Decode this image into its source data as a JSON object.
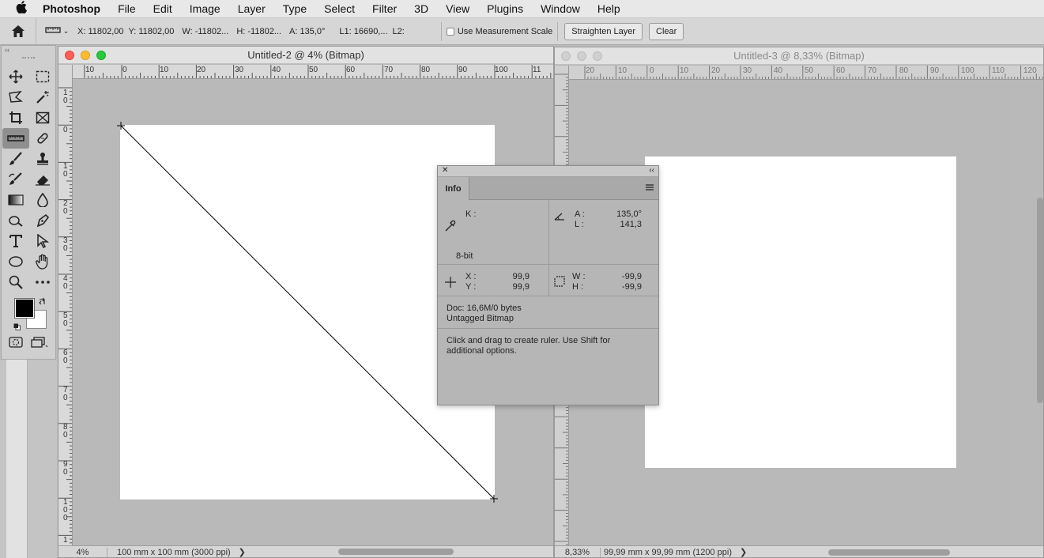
{
  "menubar": {
    "app": "Photoshop",
    "items": [
      "File",
      "Edit",
      "Image",
      "Layer",
      "Type",
      "Select",
      "Filter",
      "3D",
      "View",
      "Plugins",
      "Window",
      "Help"
    ]
  },
  "options": {
    "x": "X: 11802,00",
    "y": "Y: 11802,00",
    "w": "W: -11802...",
    "h": "H: -11802...",
    "a": "A: 135,0°",
    "l1": "L1: 16690,...",
    "l2": "L2:",
    "measurement_scale": "Use Measurement Scale",
    "straighten": "Straighten Layer",
    "clear": "Clear"
  },
  "doc1": {
    "title": "Untitled-2 @ 4% (Bitmap)",
    "zoom": "4%",
    "info": "100 mm x 100 mm (3000 ppi)",
    "chevron": "❯",
    "hruler": [
      "10",
      "0",
      "10",
      "20",
      "30",
      "40",
      "50",
      "60",
      "70",
      "80",
      "90",
      "100",
      "11"
    ],
    "vruler": [
      "1",
      "0",
      "0",
      "1",
      "0",
      "2",
      "0",
      "3",
      "0",
      "4",
      "0",
      "5",
      "0",
      "6",
      "0",
      "7",
      "0",
      "8",
      "0",
      "9",
      "0",
      "1",
      "0",
      "0",
      "1"
    ]
  },
  "doc2": {
    "title": "Untitled-3 @ 8,33% (Bitmap)",
    "zoom": "8,33%",
    "info": "99,99 mm x 99,99 mm (1200 ppi)",
    "chevron": "❯",
    "hruler": [
      "20",
      "10",
      "0",
      "10",
      "20",
      "30",
      "40",
      "50",
      "60",
      "70",
      "80",
      "90",
      "100",
      "110",
      "120"
    ]
  },
  "info_panel": {
    "tab": "Info",
    "close": "✕",
    "collapse": "‹‹",
    "k_label": "K :",
    "bit_depth": "8-bit",
    "a_label": "A :",
    "a_value": "135,0°",
    "l_label": "L :",
    "l_value": "141,3",
    "x_label": "X :",
    "x_value": "99,9",
    "y_label": "Y :",
    "y_value": "99,9",
    "w_label": "W :",
    "w_value": "-99,9",
    "h_label": "H :",
    "h_value": "-99,9",
    "doc": "Doc: 16,6M/0 bytes",
    "profile": "Untagged Bitmap",
    "hint_line1": "Click and drag to create ruler.  Use Shift for",
    "hint_line2": "additional options."
  },
  "toolbar": {
    "collapse": "‹‹"
  },
  "icons": [
    "apple-icon",
    "home-icon",
    "ruler-tool-icon",
    "move-icon",
    "marquee-icon",
    "lasso-icon",
    "magic-wand-icon",
    "crop-icon",
    "frame-icon",
    "ruler-icon",
    "healing-icon",
    "brush-icon",
    "stamp-icon",
    "history-brush-icon",
    "eraser-icon",
    "gradient-icon",
    "blur-icon",
    "dodge-icon",
    "pen-icon",
    "type-icon",
    "path-select-icon",
    "ellipse-icon",
    "hand-icon",
    "zoom-icon",
    "more-icon",
    "quick-mask-icon",
    "screen-mode-icon",
    "eyedropper-icon",
    "angle-icon",
    "crosshair-icon",
    "selection-size-icon",
    "panel-menu-icon"
  ]
}
